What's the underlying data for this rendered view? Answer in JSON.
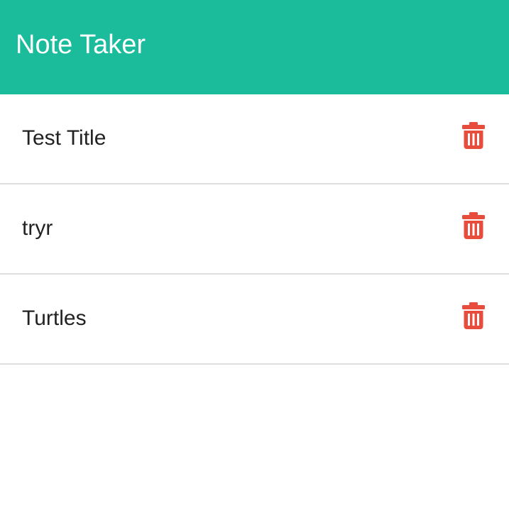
{
  "header": {
    "title": "Note Taker"
  },
  "colors": {
    "header_bg": "#1abc9c",
    "header_text": "#ffffff",
    "delete_icon": "#e74c3c",
    "divider": "#dedede",
    "note_text": "#222222"
  },
  "notes": [
    {
      "title": "Test Title",
      "delete_icon": "trash-icon"
    },
    {
      "title": "tryr",
      "delete_icon": "trash-icon"
    },
    {
      "title": "Turtles",
      "delete_icon": "trash-icon"
    }
  ]
}
